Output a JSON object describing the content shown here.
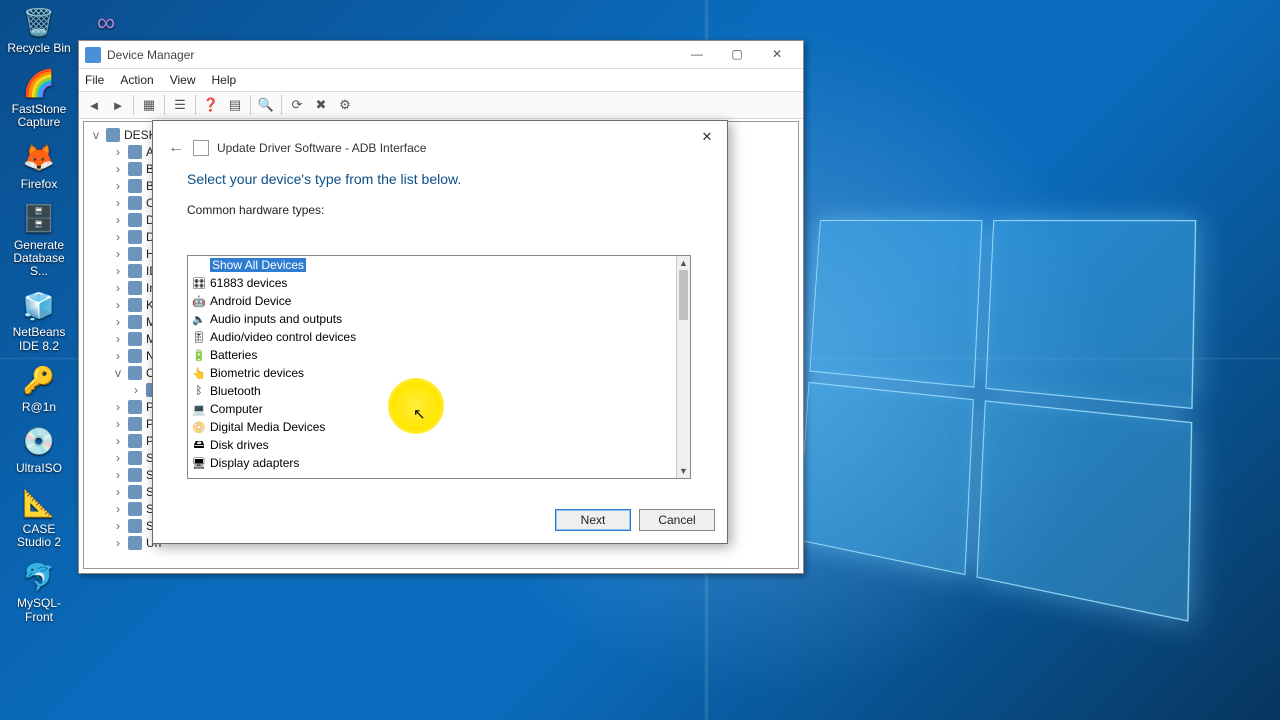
{
  "desktop_icons": [
    {
      "label": "Recycle Bin",
      "glyph": "🗑️"
    },
    {
      "label": "FastStone Capture",
      "glyph": "🌈"
    },
    {
      "label": "Firefox",
      "glyph": "🦊"
    },
    {
      "label": "Generate Database S...",
      "glyph": "🗄️"
    },
    {
      "label": "NetBeans IDE 8.2",
      "glyph": "🧊"
    },
    {
      "label": "R@1n",
      "glyph": "🔑"
    },
    {
      "label": "UltraISO",
      "glyph": "💿"
    },
    {
      "label": "CASE Studio 2",
      "glyph": "📐"
    },
    {
      "label": "MySQL-Front",
      "glyph": "🐬"
    }
  ],
  "vs_icon": {
    "label": "",
    "glyph": "∞"
  },
  "dm": {
    "title": "Device Manager",
    "menu": [
      "File",
      "Action",
      "View",
      "Help"
    ],
    "root": "DESKTOP",
    "tree": [
      "Au",
      "Ba",
      "Blu",
      "Co",
      "Dis",
      "Dis",
      "Hu",
      "IDE",
      "Im",
      "Ke",
      "Mi",
      "Mo",
      "Ne",
      "Ot",
      "",
      "Po",
      "Pri",
      "Pro",
      "Se",
      "So",
      "So",
      "Sto",
      "Sys",
      "Un"
    ]
  },
  "dialog": {
    "title": "Update Driver Software - ADB Interface",
    "heading": "Select your device's type from the list below.",
    "list_label": "Common hardware types:",
    "items": [
      {
        "label": "Show All Devices",
        "selected": true,
        "glyph": ""
      },
      {
        "label": "61883 devices",
        "glyph": "🎛"
      },
      {
        "label": "Android Device",
        "glyph": "🤖"
      },
      {
        "label": "Audio inputs and outputs",
        "glyph": "🔈"
      },
      {
        "label": "Audio/video control devices",
        "glyph": "🎚"
      },
      {
        "label": "Batteries",
        "glyph": "🔋"
      },
      {
        "label": "Biometric devices",
        "glyph": "👆"
      },
      {
        "label": "Bluetooth",
        "glyph": "ᛒ"
      },
      {
        "label": "Computer",
        "glyph": "💻"
      },
      {
        "label": "Digital Media Devices",
        "glyph": "📀"
      },
      {
        "label": "Disk drives",
        "glyph": "🖴"
      },
      {
        "label": "Display adapters",
        "glyph": "🖥"
      }
    ],
    "next": "Next",
    "cancel": "Cancel"
  }
}
